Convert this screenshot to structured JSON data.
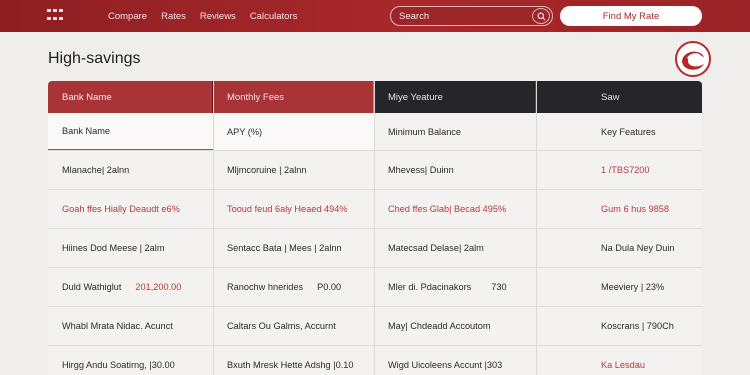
{
  "nav": {
    "logo_icon": "grid-logo-icon",
    "links": [
      "Compare",
      "Rates",
      "Reviews",
      "Calculators"
    ],
    "search_placeholder": "Search",
    "search_icon": "search-icon",
    "cta": "Find My Rate"
  },
  "page": {
    "title": "High-savings",
    "brand_icon": "red-swirl-logo-icon"
  },
  "colors": {
    "brand_red": "#a8282b",
    "header_red": "#a83437",
    "header_dark": "#26262a",
    "accent_text_red": "#b43a3d"
  },
  "table": {
    "headers": [
      "Bank Name",
      "Monthly Fees",
      "Miye Yeature",
      "Saw"
    ],
    "subheaders": [
      "Bank Name",
      "APY (%)",
      "Minimum Balance",
      "Key Features"
    ],
    "rows": [
      {
        "c1": "Mlanache| 2alnn",
        "c2": "Mljmcoruine | 2alnn",
        "c3": "Mhevess| Duinn",
        "c4": "1 /TBS7200",
        "c4_red": true
      },
      {
        "c1": "Goah ffes Hially Deaudt e6%",
        "c2": "Tooud feud 6aly Heaed 494%",
        "c3": "Ched ffes Glab| Becad 495%",
        "c4": "Gum 6 hus 9858",
        "all_red": true
      },
      {
        "c1": "Hiines Dod Meese | 2alm",
        "c2": "Sentacc Bata | Mees | 2alnn",
        "c3": "Matecsad Delase| 2alm",
        "c4": "Na Dula Ney Duin"
      },
      {
        "c1": "Duld Wathiglut",
        "c1_extra": "201,200.00",
        "c2": "Ranochw hnerides",
        "c2_extra": "P0.00",
        "c3": "Mler di. Pdacinakors",
        "c3_extra": "730",
        "c4": "Meeviery | 23%"
      },
      {
        "c1": "Whabl Mrata Nidac. Acunct",
        "c2": "Caltars Ou Galms, Accurnt",
        "c3": "May| Chdeadd Accoutom",
        "c4": "Koscrans | 790Ch"
      },
      {
        "c1": "Hirgg Andu Soatirng, |30.00",
        "c2": "Bxuth Mresk Hette Adshg |0.10",
        "c3": "Wigd Uicoleens Accunt |303",
        "c4": "Ka Lesdau",
        "c4_red": true
      }
    ]
  }
}
